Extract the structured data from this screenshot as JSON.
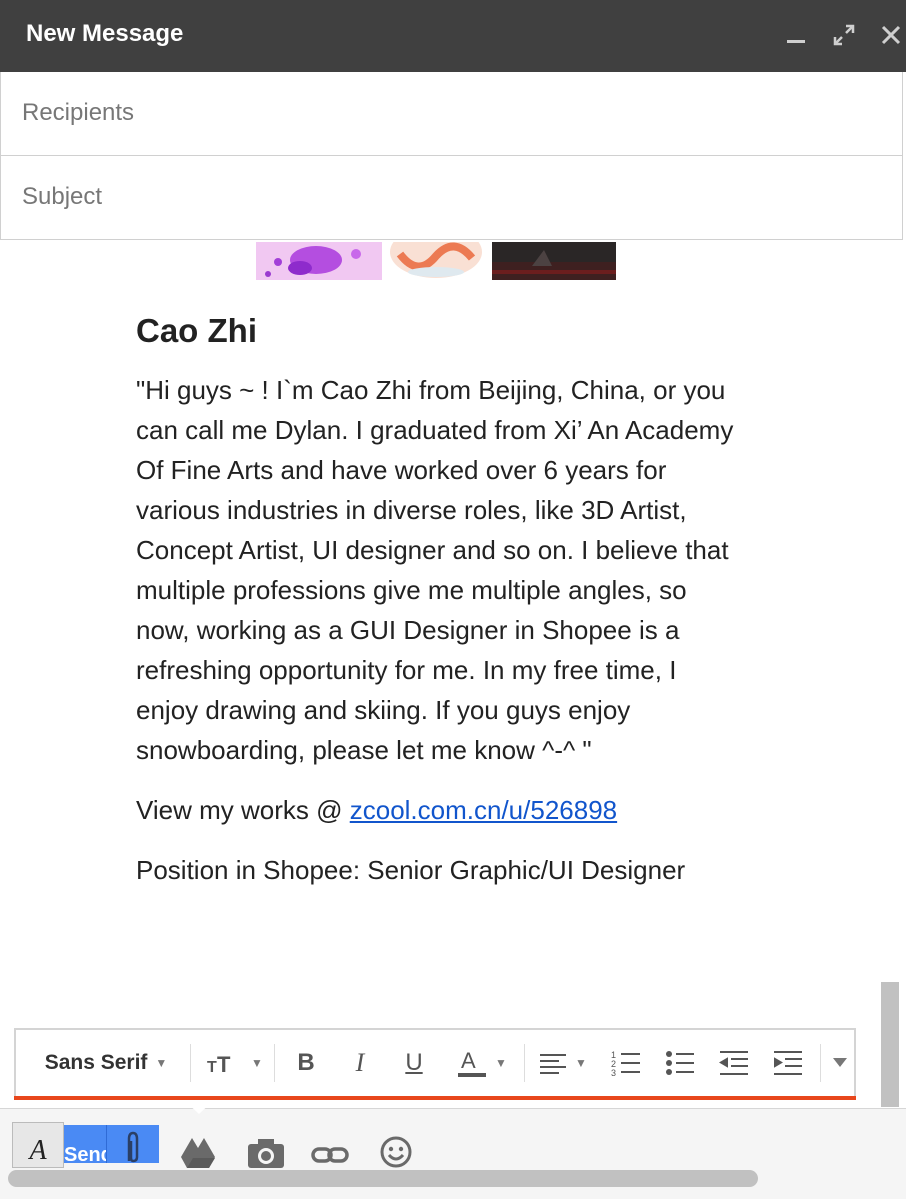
{
  "window": {
    "title": "New Message",
    "controls": {
      "minimize": "minimize-icon",
      "expand": "expand-icon",
      "close": "close-icon"
    }
  },
  "fields": {
    "recipients_placeholder": "Recipients",
    "subject_placeholder": "Subject"
  },
  "message": {
    "name": "Cao Zhi",
    "bio": "\"Hi guys ~ ! I`m Cao Zhi from Beijing, China, or you can call me Dylan. I graduated from Xi’ An Academy Of Fine Arts and have worked over 6 years for various industries in diverse roles, like 3D Artist, Concept Artist, UI designer and so on. I believe that multiple professions give me multiple angles, so now, working as a GUI Designer in Shopee is a refreshing opportunity for me. In my free time, I enjoy drawing and skiing. If you guys enjoy snowboarding, please let me know ^-^ \"",
    "works_prefix": "View my works @ ",
    "works_link": "zcool.com.cn/u/526898",
    "position": "Position in Shopee: Senior Graphic/UI Designer"
  },
  "toolbar": {
    "font_family": "Sans Serif",
    "buttons": [
      "text-size-icon",
      "bold-icon",
      "italic-icon",
      "underline-icon",
      "text-color-icon",
      "align-icon",
      "numbered-list-icon",
      "bulleted-list-icon",
      "indent-less-icon",
      "indent-more-icon",
      "more-formatting-icon"
    ]
  },
  "bottom_bar": {
    "format_label": "A",
    "send_label": "Send",
    "icons": [
      "attach-icon",
      "drive-icon",
      "photo-icon",
      "link-icon",
      "emoji-icon"
    ]
  },
  "colors": {
    "titlebar": "#404040",
    "link": "#1155cc",
    "send": "#4a8af4",
    "toolbar_accent": "#e8471c"
  }
}
